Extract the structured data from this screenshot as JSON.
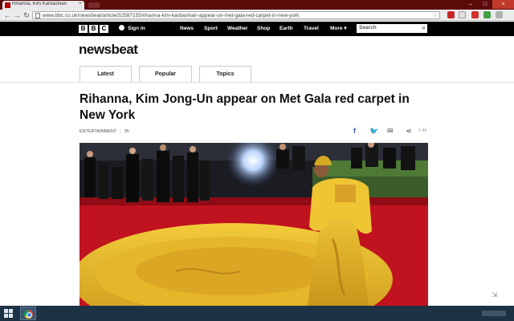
{
  "browser": {
    "tab_title": "Rihanna, Kim Kardashian",
    "tab_close": "×",
    "url": "www.bbc.co.uk/newsbeat/article/32587155/rihanna-kim-kardashian-appear-on-met-gala-red-carpet-in-new-york",
    "back_glyph": "←",
    "forward_glyph": "→",
    "reload_glyph": "↻",
    "star_glyph": "☆",
    "window_min": "–",
    "window_max": "□",
    "window_close": "×"
  },
  "bbc_bar": {
    "logo_letters": [
      "B",
      "B",
      "C"
    ],
    "sign_in": "Sign in",
    "nav": [
      "News",
      "Sport",
      "Weather",
      "Shop",
      "Earth",
      "Travel",
      "More"
    ],
    "more_arrow": "▾",
    "search_placeholder": "Search",
    "search_glyph": "⌕"
  },
  "site": {
    "brand": "newsbeat",
    "tabs": [
      "Latest",
      "Popular",
      "Topics"
    ]
  },
  "article": {
    "headline": "Rihanna, Kim Jong-Un appear on Met Gala red carpet in New York",
    "category": "ENTERTAINMENT",
    "time": "3h",
    "share_count": "1.4k"
  },
  "share_icons": {
    "facebook": "f",
    "twitter": "🐦",
    "email": "✉",
    "share": "⋖"
  },
  "colors": {
    "browser_frame": "#5d0a0a",
    "bbc_bar": "#000000",
    "facebook": "#3b5998",
    "twitter": "#1da1f2",
    "red_carpet": "#c0121f",
    "gown_gold": "#e8b820",
    "taskbar": "#1d3244"
  },
  "icons": [
    "page-icon",
    "bookmark-star-icon",
    "user-icon",
    "search-icon",
    "facebook-icon",
    "twitter-icon",
    "email-icon",
    "share-icon",
    "windows-start-icon",
    "chrome-icon"
  ]
}
